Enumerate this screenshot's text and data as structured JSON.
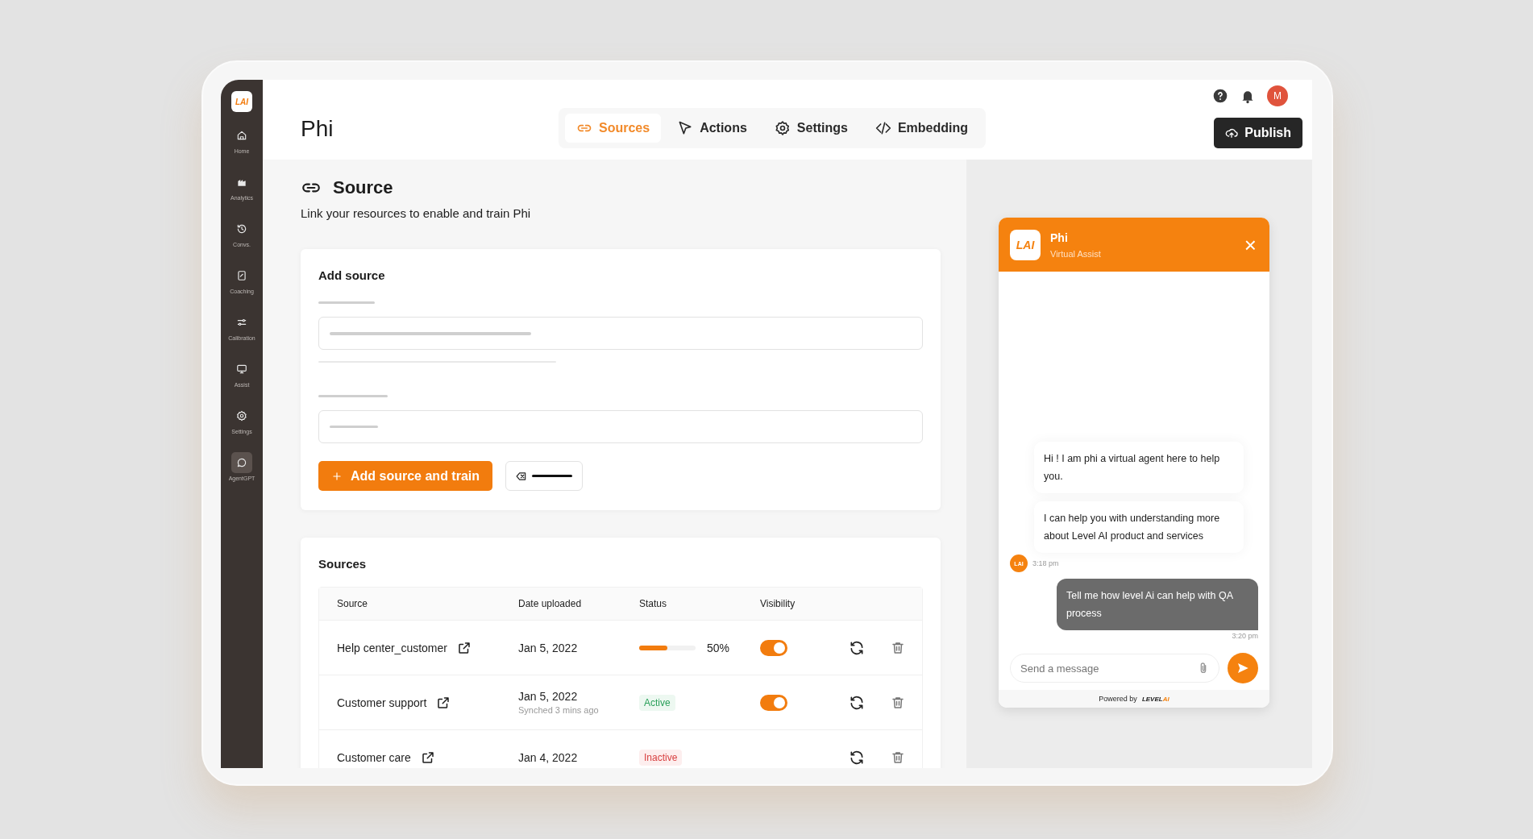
{
  "sidebar": {
    "logo": "LAI",
    "items": [
      {
        "label": "Home",
        "selected": false
      },
      {
        "label": "Analytics",
        "selected": false
      },
      {
        "label": "Convs.",
        "selected": false
      },
      {
        "label": "Coaching",
        "selected": false
      },
      {
        "label": "Calibration",
        "selected": false
      },
      {
        "label": "Assist",
        "selected": false
      },
      {
        "label": "Settings",
        "selected": false
      },
      {
        "label": "AgentGPT",
        "selected": true
      }
    ]
  },
  "header": {
    "title": "Phi",
    "tabs": [
      {
        "label": "Sources",
        "selected": true
      },
      {
        "label": "Actions",
        "selected": false
      },
      {
        "label": "Settings",
        "selected": false
      },
      {
        "label": "Embedding",
        "selected": false
      }
    ],
    "avatar": "M",
    "publish": "Publish"
  },
  "section": {
    "title": "Source",
    "subtitle": "Link your resources to enable and train Phi"
  },
  "add_source": {
    "title": "Add source",
    "primary_button": "Add source and train"
  },
  "sources": {
    "title": "Sources",
    "columns": [
      "Source",
      "Date uploaded",
      "Status",
      "Visibility"
    ],
    "rows": [
      {
        "source": "Help center_customer",
        "date": "Jan 5, 2022",
        "status": {
          "kind": "progress",
          "level": 0.5,
          "reading": "50%"
        },
        "visible": true
      },
      {
        "source": "Customer support",
        "date": "Jan 5, 2022",
        "note": "Synched 3 mins ago",
        "status": {
          "kind": "active",
          "label": "Active"
        },
        "visible": true
      },
      {
        "source": "Customer care",
        "date": "Jan 4, 2022",
        "status": {
          "kind": "inactive",
          "label": "Inactive"
        }
      }
    ]
  },
  "chat": {
    "logo": "LAI",
    "name": "Phi",
    "subtitle": "Virtual Assist",
    "close": "×",
    "messages": [
      {
        "kind": "bot",
        "text": "Hi ! I am phi a virtual agent here to help you."
      },
      {
        "kind": "bot",
        "text": "I can help you with understanding more about Level AI product and services",
        "avatar": "LAI",
        "time": "3:18 pm"
      },
      {
        "kind": "user",
        "text": "Tell me how level Ai can help with QA process",
        "time": "3:20 pm"
      }
    ],
    "input": {
      "placeholder": "Send a message"
    },
    "powered_by": "Powered by",
    "brand": "LEVEL",
    "brand_accent": "AI"
  }
}
